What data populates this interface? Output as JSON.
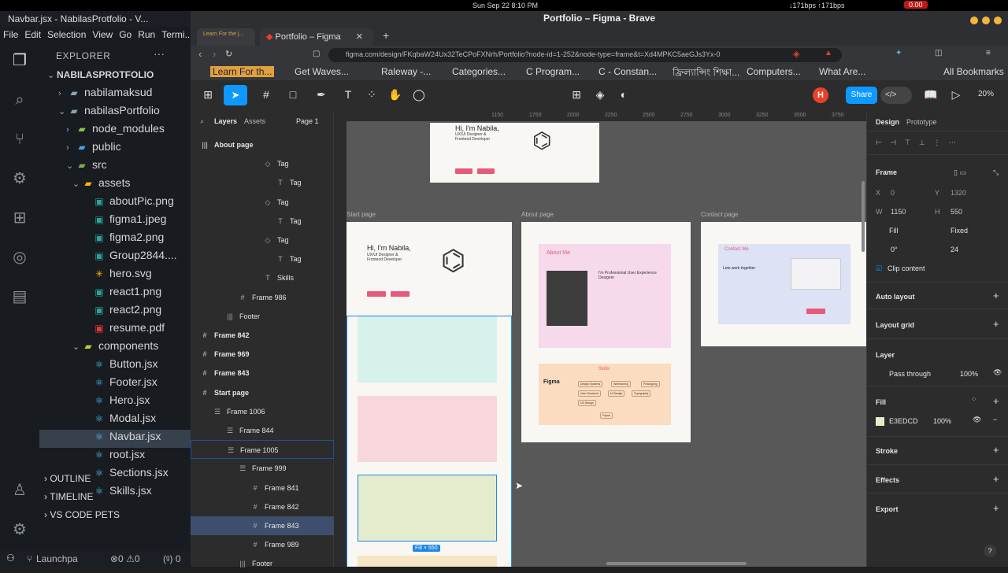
{
  "os_bar": {
    "datetime": "Sun Sep 22   8:10 PM",
    "network": "↓171bps ↑171bps",
    "battery": "0.00"
  },
  "vscode": {
    "title": "Navbar.jsx - NabilasProtfolio - V...",
    "menu": [
      "File",
      "Edit",
      "Selection",
      "View",
      "Go",
      "Run",
      "Termi..."
    ],
    "explorer_title": "EXPLORER",
    "explorer_more": "···",
    "tree": [
      {
        "label": "NABILASPROTFOLIO",
        "icon": "chevron-down",
        "kind": "root"
      },
      {
        "label": "nabilamaksud",
        "icon": "folder"
      },
      {
        "label": "nabilasPortfolio",
        "icon": "folder"
      },
      {
        "label": "node_modules",
        "icon": "folder-node"
      },
      {
        "label": "public",
        "icon": "folder-public"
      },
      {
        "label": "src",
        "icon": "folder-src"
      },
      {
        "label": "assets",
        "icon": "folder-assets"
      },
      {
        "label": "aboutPic.png",
        "icon": "image-file"
      },
      {
        "label": "figma1.jpeg",
        "icon": "image-file"
      },
      {
        "label": "figma2.png",
        "icon": "image-file"
      },
      {
        "label": "Group2844....",
        "icon": "image-file"
      },
      {
        "label": "hero.svg",
        "icon": "svg-file"
      },
      {
        "label": "react1.png",
        "icon": "image-file"
      },
      {
        "label": "react2.png",
        "icon": "image-file"
      },
      {
        "label": "resume.pdf",
        "icon": "pdf-file"
      },
      {
        "label": "components",
        "icon": "folder-components"
      },
      {
        "label": "Button.jsx",
        "icon": "react-file"
      },
      {
        "label": "Footer.jsx",
        "icon": "react-file"
      },
      {
        "label": "Hero.jsx",
        "icon": "react-file"
      },
      {
        "label": "Modal.jsx",
        "icon": "react-file"
      },
      {
        "label": "Navbar.jsx",
        "icon": "react-file",
        "selected": true
      },
      {
        "label": "root.jsx",
        "icon": "react-file"
      },
      {
        "label": "Sections.jsx",
        "icon": "react-file"
      },
      {
        "label": "Skills.jsx",
        "icon": "react-file"
      }
    ],
    "sections": [
      "OUTLINE",
      "TIMELINE",
      "VS CODE PETS"
    ],
    "status": {
      "launch": "Launchpa",
      "problems": "⊗0 ⚠0",
      "ports": "(ᵍ) 0"
    }
  },
  "browser": {
    "window_title": "Portfolio – Figma - Brave",
    "tabs": [
      {
        "label": "Learn For the j...",
        "active": false
      },
      {
        "label": "Portfolio – Figma",
        "active": true
      }
    ],
    "url": "figma.com/design/FKqbaW24Ux32TeCPoFXNrh/Portfolio?node-id=1-252&node-type=frame&t=Xd4MPKC5aeGJs3Yx-0",
    "bookmarks": [
      "Learn For th...",
      "Get Waves...",
      "Raleway -...",
      "Categories...",
      "C Program...",
      "C - Constan...",
      "ফ্রিল্যান্সিং শিক্ষা...",
      "Computers...",
      "What Are...",
      "All Bookmarks"
    ]
  },
  "figma": {
    "share_label": "Share",
    "avatar_initial": "H",
    "zoom": "20%",
    "dev_mode_label": "</>",
    "layers_panel": {
      "tab_layers": "Layers",
      "tab_assets": "Assets",
      "page": "Page 1",
      "rows": [
        {
          "label": "About page",
          "icon": "|||",
          "bold": true,
          "indent": 0
        },
        {
          "label": "Tag",
          "icon": "◇",
          "indent": 5
        },
        {
          "label": "Tag",
          "icon": "T",
          "indent": 6
        },
        {
          "label": "Tag",
          "icon": "◇",
          "indent": 5
        },
        {
          "label": "Tag",
          "icon": "T",
          "indent": 6
        },
        {
          "label": "Tag",
          "icon": "◇",
          "indent": 5
        },
        {
          "label": "Tag",
          "icon": "T",
          "indent": 6
        },
        {
          "label": "Skills",
          "icon": "T",
          "indent": 5
        },
        {
          "label": "Frame 986",
          "icon": "#",
          "indent": 3
        },
        {
          "label": "Footer",
          "icon": "|||",
          "indent": 2
        },
        {
          "label": "Frame 842",
          "icon": "#",
          "bold": true,
          "indent": 0
        },
        {
          "label": "Frame 969",
          "icon": "#",
          "bold": true,
          "indent": 0
        },
        {
          "label": "Frame 843",
          "icon": "#",
          "bold": true,
          "indent": 0
        },
        {
          "label": "Start page",
          "icon": "#",
          "bold": true,
          "indent": 0
        },
        {
          "label": "Frame 1006",
          "icon": "☰",
          "indent": 1
        },
        {
          "label": "Frame 844",
          "icon": "☰",
          "indent": 2
        },
        {
          "label": "Frame 1005",
          "icon": "☰",
          "indent": 2,
          "outline": true
        },
        {
          "label": "Frame 999",
          "icon": "☰",
          "indent": 3
        },
        {
          "label": "Frame 841",
          "icon": "#",
          "indent": 4
        },
        {
          "label": "Frame 842",
          "icon": "#",
          "indent": 4
        },
        {
          "label": "Frame 843",
          "icon": "#",
          "indent": 4,
          "selected": true
        },
        {
          "label": "Frame 989",
          "icon": "#",
          "indent": 4
        },
        {
          "label": "Footer",
          "icon": "|||",
          "indent": 3
        }
      ]
    },
    "canvas": {
      "ruler_ticks": [
        "1150",
        "1750",
        "2000",
        "2250",
        "2500",
        "2750",
        "3000",
        "3250",
        "3500",
        "3750"
      ],
      "frame_labels": [
        "Start page",
        "About page",
        "Contact page"
      ],
      "hero_heading": "Hi, I'm Nabila,",
      "hero_sub": "UX/UI Designer & Frontend Developer",
      "about_heading": "About Me",
      "about_sub": "I'm Professional User Experience Designer",
      "skills_heading": "Skills",
      "skills_tags": [
        "Design Systems",
        "Wireframing",
        "Prototyping",
        "User Research",
        "UI Design",
        "Typography",
        "UX Design",
        "Figma"
      ],
      "figma_logo_text": "Figma",
      "contact_heading": "Contact Me",
      "contact_sub": "Lets work together",
      "selection_badge": "Fill × 550",
      "strip_colors": [
        "#d7f2ec",
        "#f7d6dc",
        "#e3edcd",
        "#f7e6c5"
      ]
    },
    "props_panel": {
      "tab_design": "Design",
      "tab_prototype": "Prototype",
      "frame_label": "Frame",
      "x": "0",
      "y": "1320",
      "w": "1150",
      "h": "550",
      "w_mode": "Fill",
      "h_mode": "Fixed",
      "rotation": "0°",
      "radius": "24",
      "clip_content": "Clip content",
      "auto_layout": "Auto layout",
      "layout_grid": "Layout grid",
      "layer": "Layer",
      "blend": "Pass through",
      "layer_opacity": "100%",
      "fill": "Fill",
      "fill_hex": "E3EDCD",
      "fill_color": "#e3edcd",
      "fill_opacity": "100%",
      "stroke": "Stroke",
      "effects": "Effects",
      "export": "Export"
    }
  }
}
